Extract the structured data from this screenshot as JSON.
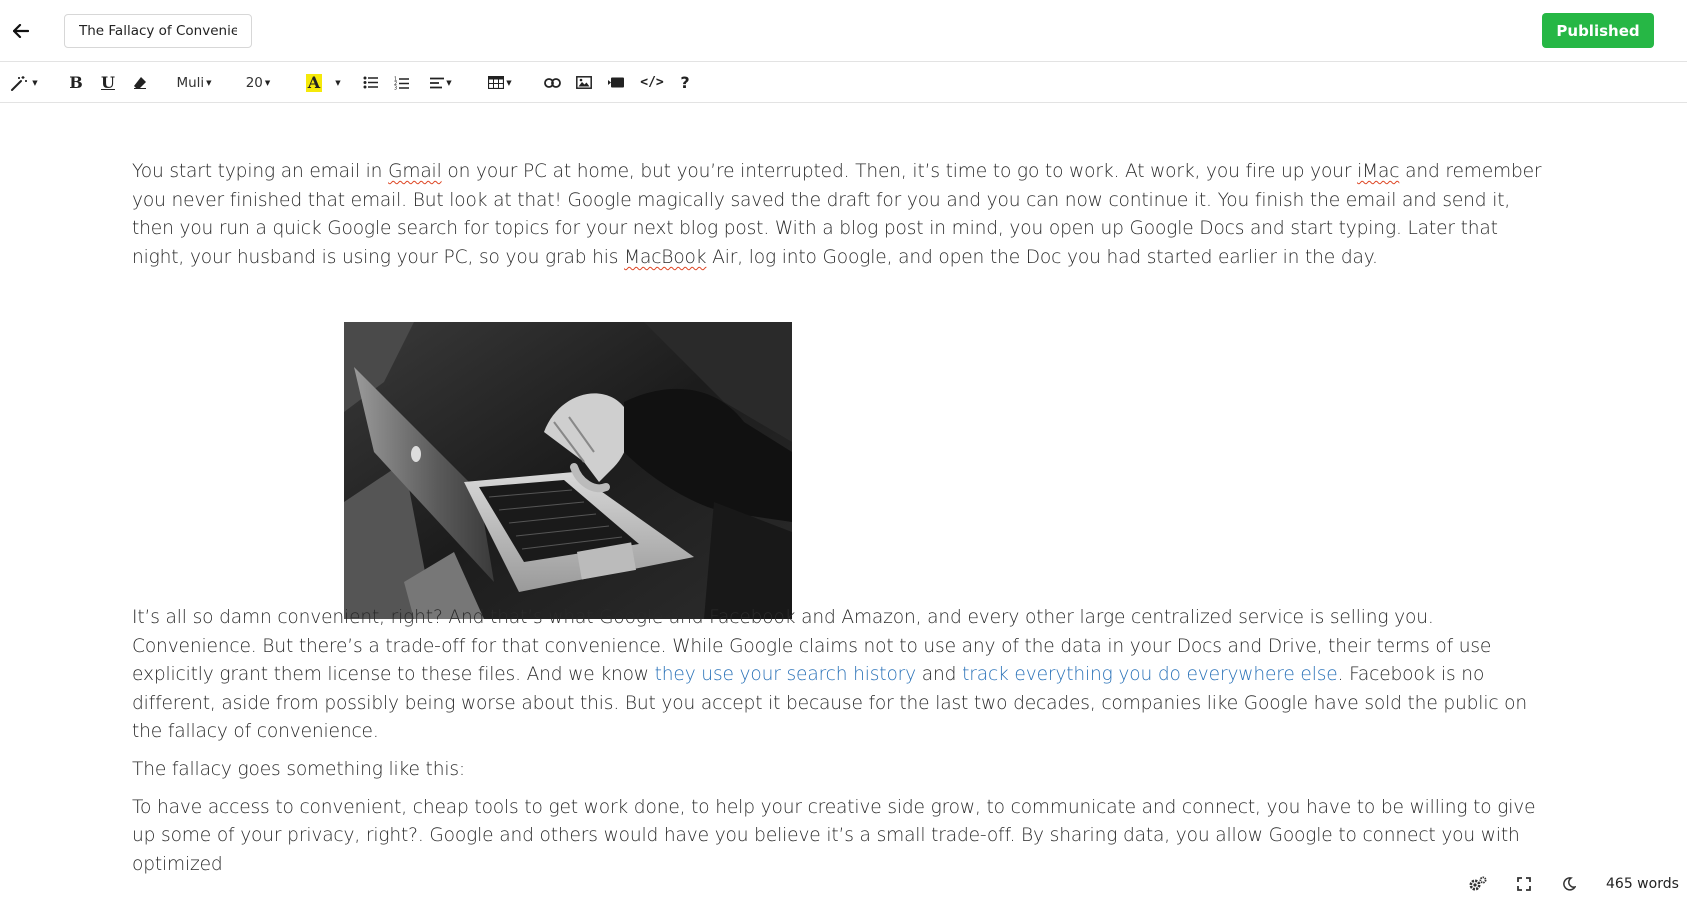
{
  "header": {
    "title_value": "The Fallacy of Convenience",
    "publish_label": "Published"
  },
  "toolbar": {
    "font_family": "Muli",
    "font_size": "20",
    "icons": [
      "magic-wand-icon",
      "bold-icon",
      "underline-icon",
      "eraser-icon",
      "text-color-icon",
      "bulleted-list-icon",
      "numbered-list-icon",
      "align-icon",
      "table-icon",
      "link-icon",
      "image-icon",
      "video-icon",
      "code-icon",
      "help-icon"
    ],
    "highlight_color": "#f5e90a"
  },
  "content": {
    "p1": {
      "a": "You start typing an email in ",
      "gmail": "Gmail",
      "b": " on your PC at home, but you’re interrupted. Then, it’s time to go to work. At work, you fire up your ",
      "imac": "iMac",
      "c": " and remember you never finished that email. But look at that! Google magically saved the draft for you and you can now continue it. You finish the email and send it, then you run a quick Google search for topics for your next blog post. With a blog post in mind, you open up Google Docs and start typing. Later that night, your husband is using your PC, so you grab his ",
      "macbook": "MacBook",
      "d": " Air, log into Google, and open the Doc you had started earlier in the day."
    },
    "p2": {
      "a": "It’s all so damn convenient, right? And that’s what Google and Facebook and Amazon, and every other large centralized service is selling you. Convenience. But there’s a trade-off for that convenience. While Google claims not to use any of the data in your Docs and Drive, their terms of use explicitly grant them license to these files. And we know ",
      "link1": "they use your search history",
      "b": " and ",
      "link2": "track everything you do everywhere else",
      "c": ". Facebook is no different, aside from possibly being worse about this. But you accept it because for the last two decades, companies like Google have sold the public on the fallacy of convenience."
    },
    "p3": "The fallacy goes something like this:",
    "p4": "To have access to convenient, cheap tools to get work done, to help your creative side grow, to communicate and connect, you have to be willing to give up some of your privacy, right?. Google and others would have you believe it’s a small trade-off. By sharing data, you allow Google to connect you with optimized",
    "link_color": "#2a72b8"
  },
  "footer": {
    "word_count": "465 words"
  },
  "colors": {
    "publish": "#26b745"
  }
}
